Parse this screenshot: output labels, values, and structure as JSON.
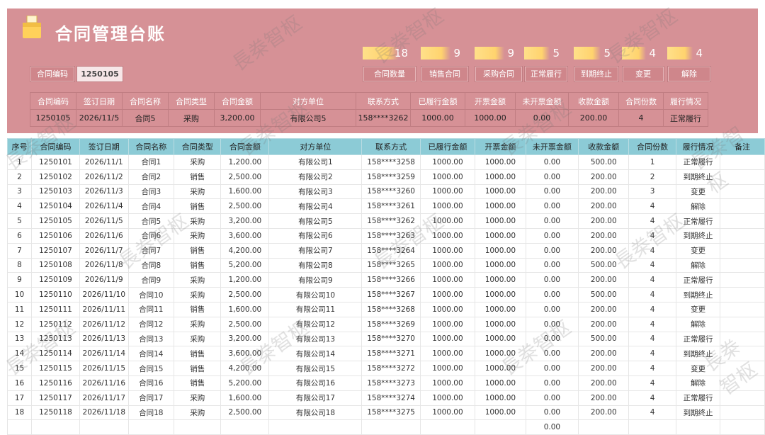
{
  "title": "合同管理台账",
  "stats": [
    {
      "value": "18",
      "label": "合同数量"
    },
    {
      "value": "9",
      "label": "销售合同"
    },
    {
      "value": "9",
      "label": "采购合同"
    },
    {
      "value": "5",
      "label": "正常履行"
    },
    {
      "value": "5",
      "label": "到期终止"
    },
    {
      "value": "4",
      "label": "变更"
    },
    {
      "value": "4",
      "label": "解除"
    }
  ],
  "lookup": {
    "label": "合同编码",
    "value": "1250105"
  },
  "summary_headers": [
    "合同编码",
    "签订日期",
    "合同名称",
    "合同类型",
    "合同金额",
    "对方单位",
    "联系方式",
    "已履行金额",
    "开票金额",
    "未开票金额",
    "收款金额",
    "合同份数",
    "履行情况"
  ],
  "summary_values": [
    "1250105",
    "2026/11/5",
    "合同5",
    "采购",
    "3,200.00",
    "有限公司5",
    "158****3262",
    "1000.00",
    "1000.00",
    "0.00",
    "200.00",
    "4",
    "正常履行"
  ],
  "table": {
    "headers": [
      "序号",
      "合同编码",
      "签订日期",
      "合同名称",
      "合同类型",
      "合同金额",
      "对方单位",
      "联系方式",
      "已履行金额",
      "开票金额",
      "未开票金额",
      "收款金额",
      "合同份数",
      "履行情况",
      "备注"
    ],
    "rows": [
      [
        "1",
        "1250101",
        "2026/11/1",
        "合同1",
        "采购",
        "1,200.00",
        "有限公司1",
        "158****3258",
        "1000.00",
        "1000.00",
        "0.00",
        "500.00",
        "1",
        "正常履行",
        ""
      ],
      [
        "2",
        "1250102",
        "2026/11/2",
        "合同2",
        "销售",
        "2,500.00",
        "有限公司2",
        "158****3259",
        "1000.00",
        "1000.00",
        "0.00",
        "200.00",
        "2",
        "到期终止",
        ""
      ],
      [
        "3",
        "1250103",
        "2026/11/3",
        "合同3",
        "采购",
        "1,600.00",
        "有限公司3",
        "158****3260",
        "1000.00",
        "1000.00",
        "0.00",
        "200.00",
        "3",
        "变更",
        ""
      ],
      [
        "4",
        "1250104",
        "2026/11/4",
        "合同4",
        "销售",
        "2,500.00",
        "有限公司4",
        "158****3261",
        "1000.00",
        "1000.00",
        "0.00",
        "200.00",
        "4",
        "解除",
        ""
      ],
      [
        "5",
        "1250105",
        "2026/11/5",
        "合同5",
        "采购",
        "3,200.00",
        "有限公司5",
        "158****3262",
        "1000.00",
        "1000.00",
        "0.00",
        "200.00",
        "4",
        "正常履行",
        ""
      ],
      [
        "6",
        "1250106",
        "2026/11/6",
        "合同6",
        "采购",
        "3,600.00",
        "有限公司6",
        "158****3263",
        "1000.00",
        "1000.00",
        "0.00",
        "200.00",
        "4",
        "到期终止",
        ""
      ],
      [
        "7",
        "1250107",
        "2026/11/7",
        "合同7",
        "销售",
        "4,200.00",
        "有限公司7",
        "158****3264",
        "1000.00",
        "1000.00",
        "0.00",
        "200.00",
        "4",
        "变更",
        ""
      ],
      [
        "8",
        "1250108",
        "2026/11/8",
        "合同8",
        "销售",
        "5,200.00",
        "有限公司8",
        "158****3265",
        "1000.00",
        "1000.00",
        "0.00",
        "500.00",
        "4",
        "解除",
        ""
      ],
      [
        "9",
        "1250109",
        "2026/11/9",
        "合同9",
        "采购",
        "1,200.00",
        "有限公司9",
        "158****3266",
        "1000.00",
        "1000.00",
        "0.00",
        "200.00",
        "4",
        "正常履行",
        ""
      ],
      [
        "10",
        "1250110",
        "2026/11/10",
        "合同10",
        "采购",
        "2,500.00",
        "有限公司10",
        "158****3267",
        "1000.00",
        "1000.00",
        "0.00",
        "500.00",
        "4",
        "到期终止",
        ""
      ],
      [
        "11",
        "1250111",
        "2026/11/11",
        "合同11",
        "销售",
        "1,600.00",
        "有限公司11",
        "158****3268",
        "1000.00",
        "1000.00",
        "0.00",
        "200.00",
        "4",
        "变更",
        ""
      ],
      [
        "12",
        "1250112",
        "2026/11/12",
        "合同12",
        "采购",
        "2,500.00",
        "有限公司12",
        "158****3269",
        "1000.00",
        "1000.00",
        "0.00",
        "200.00",
        "4",
        "解除",
        ""
      ],
      [
        "13",
        "1250113",
        "2026/11/13",
        "合同13",
        "采购",
        "3,200.00",
        "有限公司13",
        "158****3270",
        "1000.00",
        "1000.00",
        "0.00",
        "500.00",
        "4",
        "正常履行",
        ""
      ],
      [
        "14",
        "1250114",
        "2026/11/14",
        "合同14",
        "销售",
        "3,600.00",
        "有限公司14",
        "158****3271",
        "1000.00",
        "1000.00",
        "0.00",
        "200.00",
        "4",
        "到期终止",
        ""
      ],
      [
        "15",
        "1250115",
        "2026/11/15",
        "合同15",
        "销售",
        "4,200.00",
        "有限公司15",
        "158****3272",
        "1000.00",
        "1000.00",
        "0.00",
        "200.00",
        "4",
        "变更",
        ""
      ],
      [
        "16",
        "1250116",
        "2026/11/16",
        "合同16",
        "销售",
        "5,200.00",
        "有限公司16",
        "158****3273",
        "1000.00",
        "1000.00",
        "0.00",
        "200.00",
        "4",
        "解除",
        ""
      ],
      [
        "17",
        "1250117",
        "2026/11/17",
        "合同17",
        "采购",
        "1,600.00",
        "有限公司17",
        "158****3274",
        "1000.00",
        "1000.00",
        "0.00",
        "200.00",
        "4",
        "正常履行",
        ""
      ],
      [
        "18",
        "1250118",
        "2026/11/18",
        "合同18",
        "采购",
        "2,500.00",
        "有限公司18",
        "158****3275",
        "1000.00",
        "1000.00",
        "0.00",
        "200.00",
        "4",
        "到期终止",
        ""
      ],
      [
        "",
        "",
        "",
        "",
        "",
        "",
        "",
        "",
        "",
        "",
        "0.00",
        "",
        "",
        "",
        ""
      ]
    ]
  },
  "watermark": "長桊智枢",
  "colors": {
    "header_band": "#d69196",
    "table_header": "#8ccbd6",
    "buy": "#cc1b22",
    "sell": "#12a83a"
  }
}
